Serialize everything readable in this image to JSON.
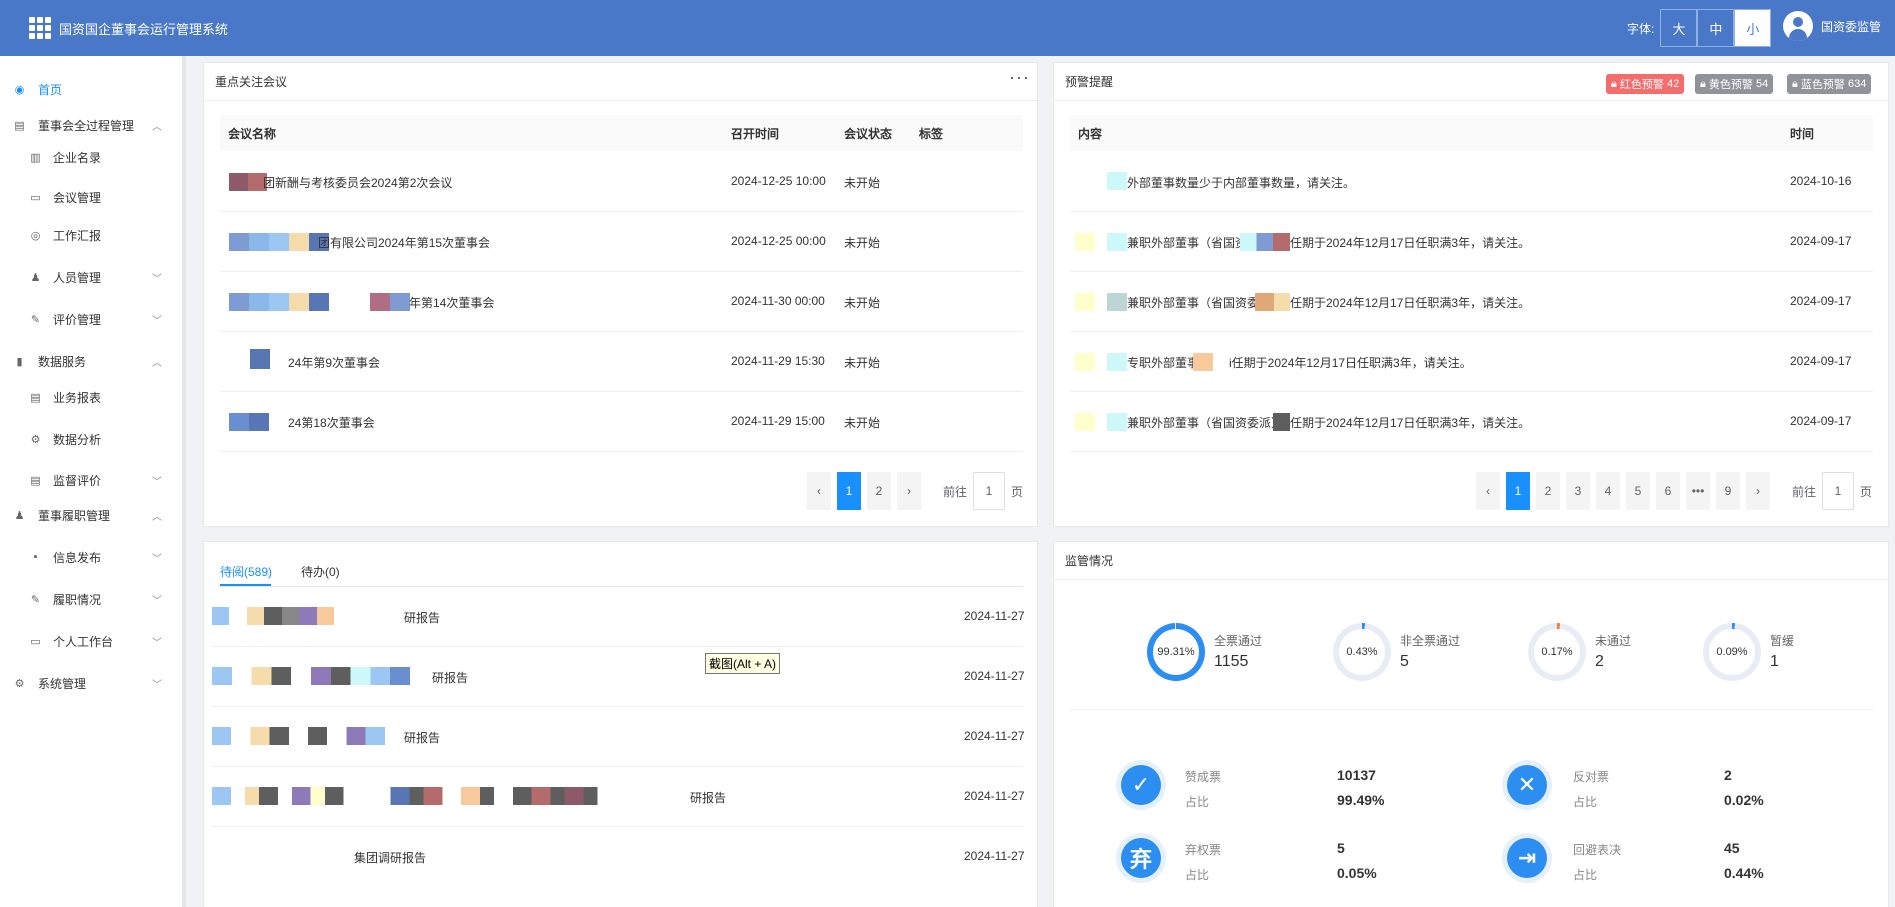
{
  "header": {
    "title": "国资国企董事会运行管理系统",
    "font_label": "字体:",
    "font_sizes": [
      "大",
      "中",
      "小"
    ],
    "user": "国资委监管"
  },
  "sidebar": {
    "items": [
      {
        "label": "首页"
      },
      {
        "label": "董事会全过程管理"
      },
      {
        "label": "企业名录"
      },
      {
        "label": "会议管理"
      },
      {
        "label": "工作汇报"
      },
      {
        "label": "人员管理"
      },
      {
        "label": "评价管理"
      },
      {
        "label": "数据服务"
      },
      {
        "label": "业务报表"
      },
      {
        "label": "数据分析"
      },
      {
        "label": "监督评价"
      },
      {
        "label": "董事履职管理"
      },
      {
        "label": "信息发布"
      },
      {
        "label": "履职情况"
      },
      {
        "label": "个人工作台"
      },
      {
        "label": "系统管理"
      }
    ]
  },
  "meetings": {
    "title": "重点关注会议",
    "more_icon": "ellipsis-icon",
    "columns": [
      "会议名称",
      "召开时间",
      "会议状态",
      "标签"
    ],
    "rows": [
      {
        "name": "团新酬与考核委员会2024第2次会议",
        "time": "2024-12-25 10:00",
        "status": "未开始"
      },
      {
        "name": "团有限公司2024年第15次董事会",
        "time": "2024-12-25 00:00",
        "status": "未开始"
      },
      {
        "name": "年第14次董事会",
        "time": "2024-11-30 00:00",
        "status": "未开始"
      },
      {
        "name": "24年第9次董事会",
        "time": "2024-11-29 15:30",
        "status": "未开始"
      },
      {
        "name": "24第18次董事会",
        "time": "2024-11-29 15:00",
        "status": "未开始"
      }
    ],
    "pager": {
      "pages": [
        "1",
        "2"
      ],
      "current": "1",
      "goto_label": "前往",
      "goto_value": "1",
      "page_unit": "页"
    }
  },
  "warnings": {
    "title": "预警提醒",
    "badges": [
      {
        "label": "红色预警",
        "count": "42",
        "color": "#f56c6c"
      },
      {
        "label": "黄色预警",
        "count": "54",
        "color": "#909399"
      },
      {
        "label": "蓝色预警",
        "count": "634",
        "color": "#909399"
      }
    ],
    "columns": [
      "内容",
      "时间"
    ],
    "rows": [
      {
        "content": "外部董事数量少于内部董事数量，请关注。",
        "time": "2024-10-16"
      },
      {
        "content": "兼职外部董事（省国资委委",
        "content2": "任期于2024年12月17日任职满3年，请关注。",
        "time": "2024-09-17"
      },
      {
        "content": "兼职外部董事（省国资委派）",
        "content2": "任期于2024年12月17日任职满3年，请关注。",
        "time": "2024-09-17"
      },
      {
        "content": "专职外部董事",
        "content2": "i任期于2024年12月17日任职满3年，请关注。",
        "time": "2024-09-17"
      },
      {
        "content": "兼职外部董事（省国资委派）",
        "content2": "任期于2024年12月17日任职满3年，请关注。",
        "time": "2024-09-17"
      }
    ],
    "pager": {
      "pages": [
        "1",
        "2",
        "3",
        "4",
        "5",
        "6",
        "•••",
        "9"
      ],
      "current": "1",
      "goto_label": "前往",
      "goto_value": "1",
      "page_unit": "页"
    }
  },
  "todo": {
    "tabs": [
      "待阅(589)",
      "待办(0)"
    ],
    "rows": [
      {
        "text": "研报告",
        "date": "2024-11-27"
      },
      {
        "text": "研报告",
        "date": "2024-11-27"
      },
      {
        "text": "研报告",
        "date": "2024-11-27"
      },
      {
        "text": "研报告",
        "date": "2024-11-27"
      },
      {
        "text": "集团调研报告",
        "date": "2024-11-27"
      }
    ]
  },
  "tooltip": "截图(Alt + A)",
  "supervision": {
    "title": "监管情况",
    "stats": [
      {
        "pct": "99.31%",
        "label": "全票通过",
        "value": "1155",
        "fraction": 0.9931
      },
      {
        "pct": "0.43%",
        "label": "非全票通过",
        "value": "5",
        "fraction": 0.0043
      },
      {
        "pct": "0.17%",
        "label": "未通过",
        "value": "2",
        "fraction": 0.0017
      },
      {
        "pct": "0.09%",
        "label": "暂缓",
        "value": "1",
        "fraction": 0.0009
      }
    ],
    "stat_colors": [
      "#2b8ef0",
      "#2b8ef0",
      "#ff7a2e",
      "#2b8ef0"
    ],
    "votes": [
      {
        "label": "赞成票",
        "value": "10137",
        "ratio_label": "占比",
        "ratio": "99.49%",
        "icon": "check-icon",
        "glyph": "✓"
      },
      {
        "label": "反对票",
        "value": "2",
        "ratio_label": "占比",
        "ratio": "0.02%",
        "icon": "cross-icon",
        "glyph": "✕"
      },
      {
        "label": "弃权票",
        "value": "5",
        "ratio_label": "占比",
        "ratio": "0.05%",
        "icon": "abstain-icon",
        "glyph": "弃"
      },
      {
        "label": "回避表决",
        "value": "45",
        "ratio_label": "占比",
        "ratio": "0.44%",
        "icon": "walk-away-icon",
        "glyph": "⇥"
      }
    ]
  }
}
